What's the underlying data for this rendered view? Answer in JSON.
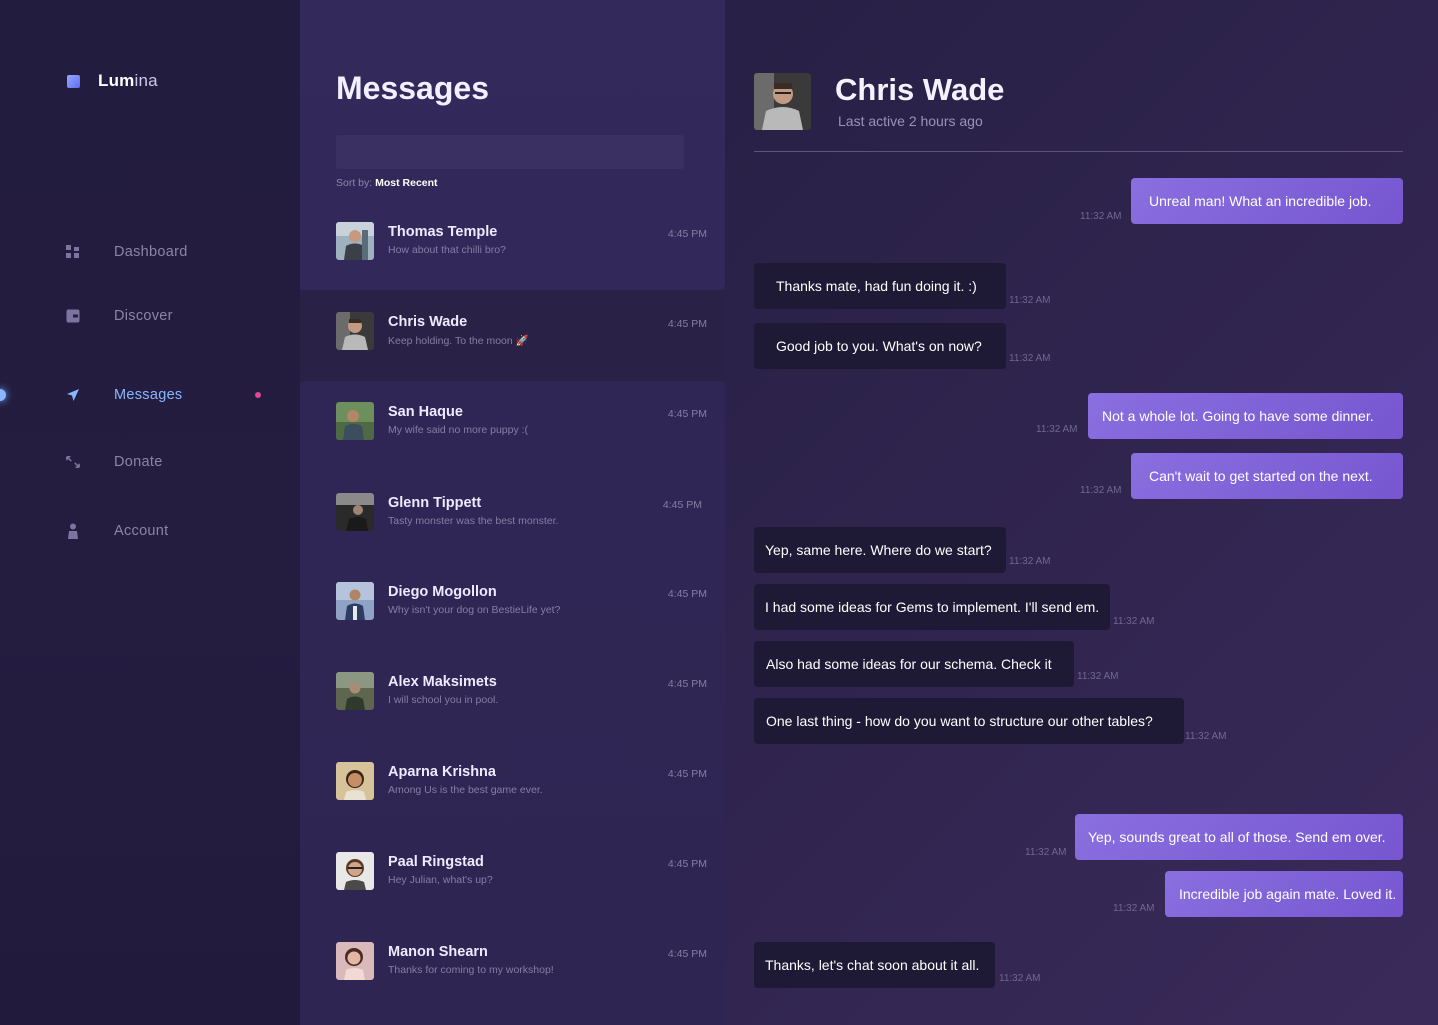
{
  "brand": {
    "name_bold": "Lum",
    "name_rest": "ina"
  },
  "nav": [
    {
      "label": "Dashboard",
      "icon": "grid-icon"
    },
    {
      "label": "Discover",
      "icon": "wallet-icon"
    },
    {
      "label": "Messages",
      "icon": "send-icon",
      "active": true,
      "has_notification": true
    },
    {
      "label": "Donate",
      "icon": "arrows-icon"
    },
    {
      "label": "Account",
      "icon": "person-icon"
    }
  ],
  "list": {
    "title": "Messages",
    "search_placeholder": "",
    "sort_prefix": "Sort by:",
    "sort_value": "Most Recent",
    "contacts": [
      {
        "name": "Thomas Temple",
        "preview": "How about that chilli bro?",
        "time": "4:45 PM"
      },
      {
        "name": "Chris Wade",
        "preview": "Keep holding. To the moon 🚀",
        "time": "4:45 PM"
      },
      {
        "name": "San Haque",
        "preview": "My wife said no more puppy :(",
        "time": "4:45 PM"
      },
      {
        "name": "Glenn Tippett",
        "preview": "Tasty monster was the best monster.",
        "time": "4:45 PM"
      },
      {
        "name": "Diego Mogollon",
        "preview": "Why isn't your dog on BestieLife yet?",
        "time": "4:45 PM"
      },
      {
        "name": "Alex Maksimets",
        "preview": "I will school you in pool.",
        "time": "4:45 PM"
      },
      {
        "name": "Aparna Krishna",
        "preview": "Among Us is the best game ever.",
        "time": "4:45 PM"
      },
      {
        "name": "Paal Ringstad",
        "preview": "Hey Julian, what's up?",
        "time": "4:45 PM"
      },
      {
        "name": "Manon Shearn",
        "preview": "Thanks for coming to my workshop!",
        "time": "4:45 PM"
      }
    ]
  },
  "chat": {
    "name": "Chris Wade",
    "status": "Last active 2 hours ago",
    "messages": [
      {
        "text": "Unreal man! What an incredible job.",
        "time": "11:32 AM",
        "dir": "out"
      },
      {
        "text": "Thanks mate, had fun doing it. :)",
        "time": "11:32 AM",
        "dir": "in"
      },
      {
        "text": "Good job to you. What's on now?",
        "time": "11:32 AM",
        "dir": "in"
      },
      {
        "text": "Not a whole lot. Going to have some dinner.",
        "time": "11:32 AM",
        "dir": "out"
      },
      {
        "text": "Can't wait to get started on the next.",
        "time": "11:32 AM",
        "dir": "out"
      },
      {
        "text": "Yep, same here. Where do we start?",
        "time": "11:32 AM",
        "dir": "in"
      },
      {
        "text": "I had some ideas for Gems to implement. I'll send em.",
        "time": "11:32 AM",
        "dir": "in"
      },
      {
        "text": "Also had some ideas for our schema. Check it",
        "time": "11:32 AM",
        "dir": "in"
      },
      {
        "text": "One last thing - how do you want to structure our other tables?",
        "time": "11:32 AM",
        "dir": "in"
      },
      {
        "text": "Yep, sounds great to all of those. Send em over.",
        "time": "11:32 AM",
        "dir": "out"
      },
      {
        "text": "Incredible job again mate. Loved it.",
        "time": "11:32 AM",
        "dir": "out"
      },
      {
        "text": "Thanks, let's chat soon about it all.",
        "time": "11:32 AM",
        "dir": "in"
      }
    ]
  },
  "colors": {
    "accent": "#8ab6ff",
    "notification": "#e0488f",
    "outgoing_bubble": "#7f63d8",
    "incoming_bubble": "#1e1934"
  }
}
